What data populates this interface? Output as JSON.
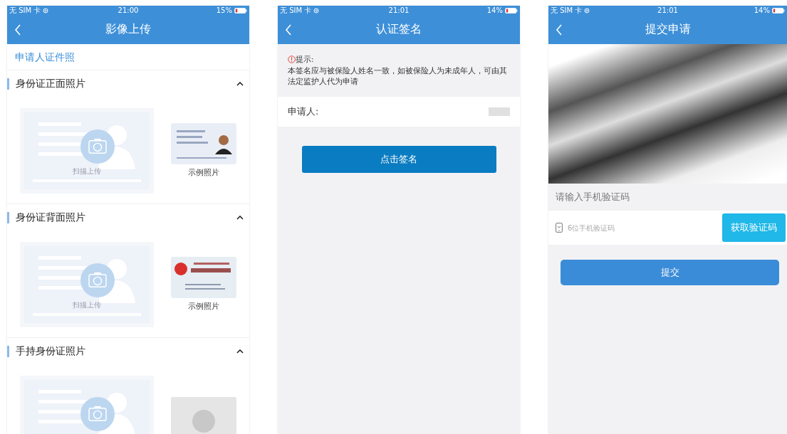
{
  "screens": [
    {
      "kind": "upload",
      "status_bar": {
        "carrier": "无 SIM 卡",
        "time": "21:00",
        "battery": "15%"
      },
      "title": "影像上传",
      "section_title": "申请人证件照",
      "groups": [
        {
          "title": "身份证正面照片",
          "expanded": true,
          "upload_label": "扫描上传",
          "kind": "id-front",
          "example_label": "示例照片"
        },
        {
          "title": "身份证背面照片",
          "expanded": true,
          "upload_label": "扫描上传",
          "kind": "id-back",
          "example_label": "示例照片"
        },
        {
          "title": "手持身份证照片",
          "expanded": true,
          "kind": "holding"
        }
      ]
    },
    {
      "kind": "sign",
      "status_bar": {
        "carrier": "无 SIM 卡",
        "time": "21:01",
        "battery": "14%"
      },
      "title": "认证签名",
      "tip_title": "提示:",
      "tip_text": "本签名应与被保险人姓名一致，如被保险人为未成年人，可由其法定监护人代为申请",
      "field_label": "申请人:",
      "button": "点击签名"
    },
    {
      "kind": "submit",
      "status_bar": {
        "carrier": "无 SIM 卡",
        "time": "21:01",
        "battery": "14%"
      },
      "title": "提交申请",
      "code_label": "请输入手机验证码",
      "code_placeholder": "6位手机验证码",
      "code_button": "获取验证码",
      "button": "提交"
    }
  ]
}
